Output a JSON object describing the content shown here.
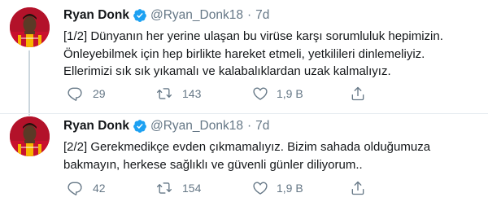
{
  "tweets": [
    {
      "author": "Ryan Donk",
      "handle": "@Ryan_Donk18",
      "separator": "·",
      "time": "7d",
      "lines": [
        "[1/2] Dünyanın her yerine ulaşan bu virüse karşı sorumluluk hepimizin.",
        "Önleyebilmek için hep birlikte hareket etmeli, yetkilileri dinlemeliyiz.",
        "Ellerimizi sık sık yıkamalı ve kalabalıklardan uzak kalmalıyız."
      ],
      "replies": "29",
      "retweets": "143",
      "likes": "1,9 B"
    },
    {
      "author": "Ryan Donk",
      "handle": "@Ryan_Donk18",
      "separator": "·",
      "time": "7d",
      "lines": [
        "[2/2] Gerekmedikçe evden çıkmamalıyız. Bizim sahada olduğumuza",
        "bakmayın, herkese sağlıklı ve güvenli günler diliyorum.."
      ],
      "replies": "42",
      "retweets": "154",
      "likes": "1,9 B"
    }
  ],
  "icons": {
    "verified": "verified-badge-icon",
    "reply": "reply-icon",
    "retweet": "retweet-icon",
    "like": "heart-icon",
    "share": "share-icon"
  },
  "colors": {
    "verified_blue": "#1da1f2",
    "text_primary": "#14171a",
    "text_secondary": "#657786",
    "thread_line": "#ccd6dd",
    "jersey_red": "#c8102e",
    "jersey_yellow": "#f7b500"
  }
}
